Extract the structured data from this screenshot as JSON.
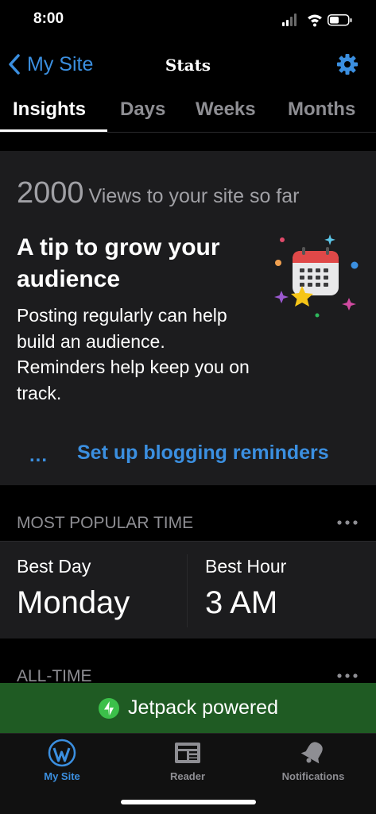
{
  "status_bar": {
    "time": "8:00"
  },
  "nav": {
    "back_label": "My Site",
    "title": "Stats"
  },
  "tabs": [
    {
      "label": "Insights",
      "active": true
    },
    {
      "label": "Days",
      "active": false
    },
    {
      "label": "Weeks",
      "active": false
    },
    {
      "label": "Months",
      "active": false
    }
  ],
  "views_card": {
    "views_count": "2000",
    "views_text": "Views to your site so far",
    "tip_title": "A tip to grow your audience",
    "tip_body": "Posting regularly can help build an audience. Reminders help keep you on track.",
    "more_label": "...",
    "cta_label": "Set up blogging reminders"
  },
  "popular_time": {
    "header": "MOST POPULAR TIME",
    "best_day_label": "Best Day",
    "best_day_value": "Monday",
    "best_hour_label": "Best Hour",
    "best_hour_value": "3 AM"
  },
  "all_time": {
    "header": "ALL-TIME"
  },
  "jetpack_banner": {
    "label": "Jetpack powered"
  },
  "tab_bar": {
    "items": [
      {
        "label": "My Site",
        "icon": "wordpress-icon",
        "active": true
      },
      {
        "label": "Reader",
        "icon": "reader-icon",
        "active": false
      },
      {
        "label": "Notifications",
        "icon": "bell-icon",
        "active": false
      }
    ]
  },
  "colors": {
    "accent": "#3b8fe0",
    "jetpack_green": "#1f5b23",
    "card_bg": "#1c1c1e"
  }
}
